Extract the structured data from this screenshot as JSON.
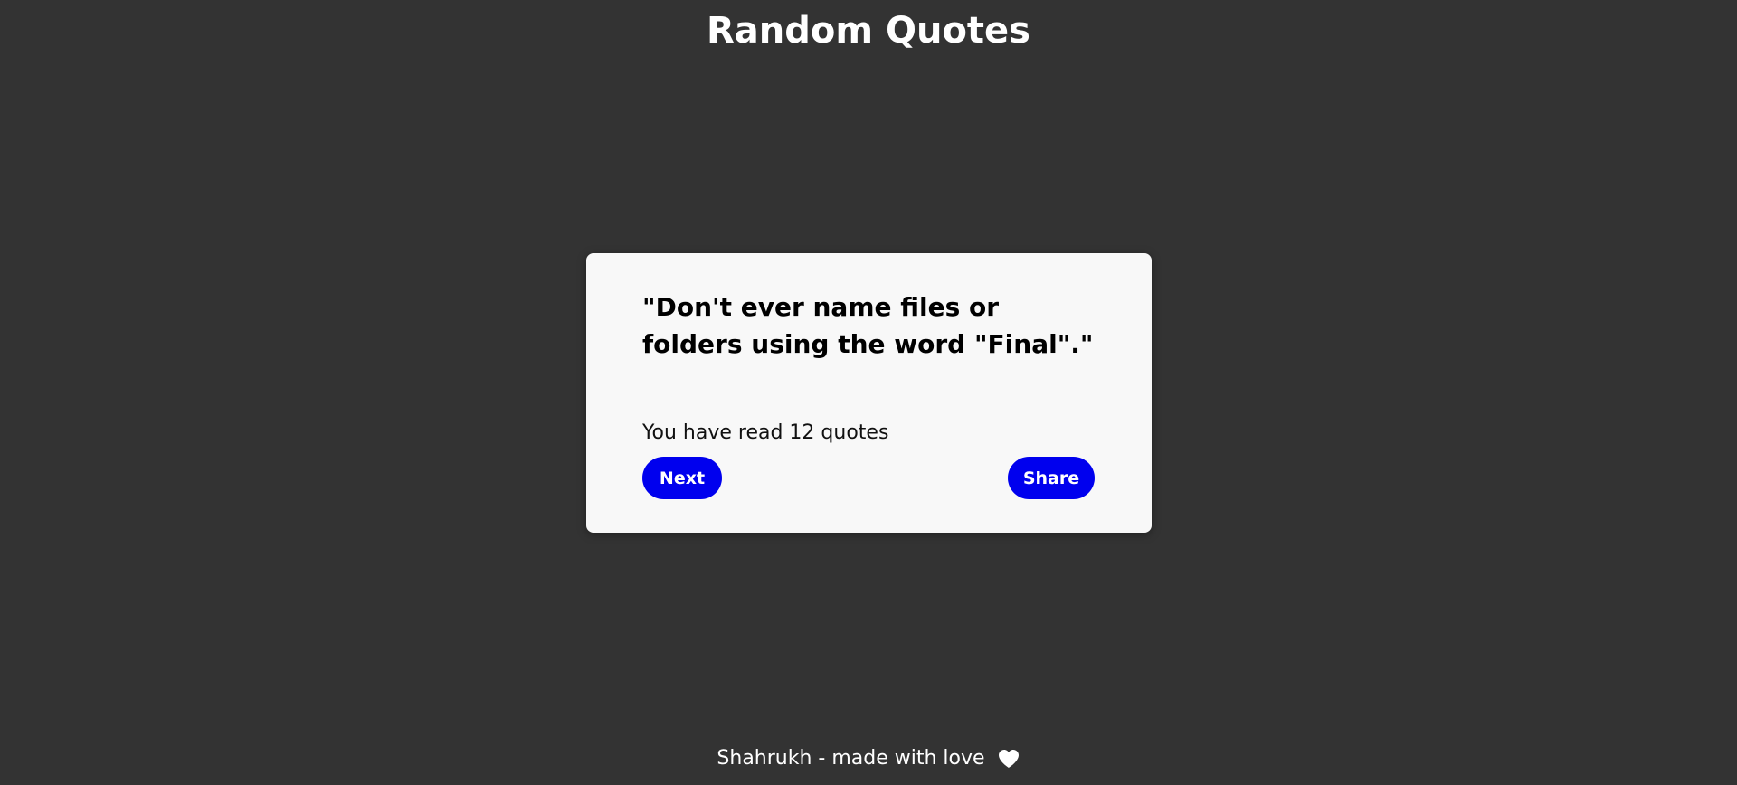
{
  "header": {
    "title": "Random Quotes"
  },
  "card": {
    "quote": "\"Don't ever name files or folders using the word \"Final\".\"",
    "read_count_text": "You have read 12 quotes",
    "next_label": "Next",
    "share_label": "Share"
  },
  "footer": {
    "text": "Shahrukh - made with love",
    "icon": "heart-icon"
  },
  "colors": {
    "background": "#333333",
    "card": "#f8f8f8",
    "button": "#0000ee",
    "text_light": "#ffffff"
  }
}
